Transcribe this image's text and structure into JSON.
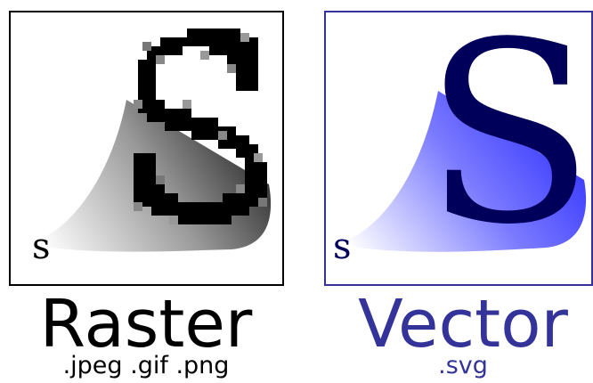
{
  "colors": {
    "raster_border": "#000000",
    "raster_letter": "#000000",
    "vector_border": "#333399",
    "vector_letter": "#00005a",
    "vector_title": "#333399",
    "vector_gradient_end": "#4444ff"
  },
  "raster": {
    "small_letter": "s",
    "big_letter": "S",
    "title": "Raster",
    "formats": ".jpeg .gif .png"
  },
  "vector": {
    "small_letter": "s",
    "big_letter": "S",
    "title": "Vector",
    "formats": ".svg"
  }
}
